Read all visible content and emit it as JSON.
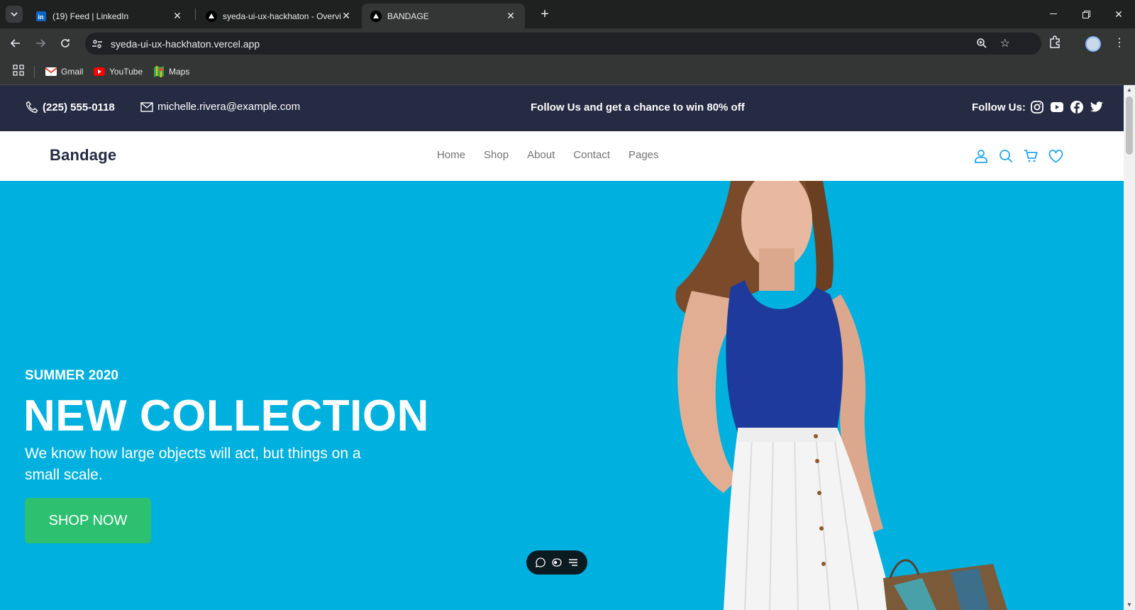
{
  "browser": {
    "tabs": [
      {
        "title": "(19) Feed | LinkedIn",
        "active": false
      },
      {
        "title": "syeda-ui-ux-hackhaton - Overview",
        "active": false
      },
      {
        "title": "BANDAGE",
        "active": true
      }
    ],
    "url": "syeda-ui-ux-hackhaton.vercel.app",
    "bookmarks": [
      "Gmail",
      "YouTube",
      "Maps"
    ]
  },
  "topbar": {
    "phone": "(225) 555-0118",
    "email": "michelle.rivera@example.com",
    "promo": "Follow Us and get a chance to win 80% off",
    "follow_label": "Follow Us:",
    "social": [
      "instagram-icon",
      "youtube-icon",
      "facebook-icon",
      "twitter-icon"
    ]
  },
  "header": {
    "brand": "Bandage",
    "nav": [
      "Home",
      "Shop",
      "About",
      "Contact",
      "Pages"
    ],
    "icons": [
      "user-icon",
      "search-icon",
      "cart-icon",
      "heart-icon"
    ]
  },
  "hero": {
    "season": "SUMMER 2020",
    "headline": "NEW COLLECTION",
    "description": "We know how large objects will act, but things on a small scale.",
    "cta": "SHOP NOW"
  },
  "colors": {
    "topbar_bg": "#252B42",
    "hero_bg": "#00B0DE",
    "cta_bg": "#2DC071",
    "accent": "#23A6F0"
  }
}
